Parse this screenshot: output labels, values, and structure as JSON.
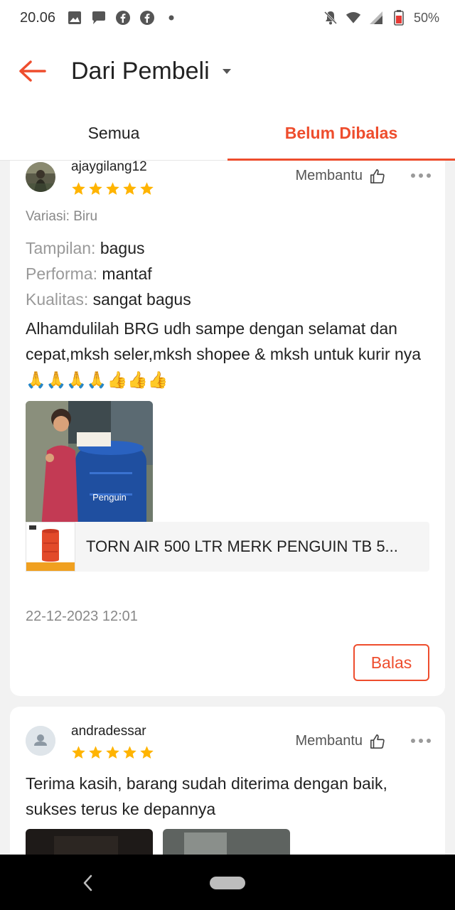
{
  "status_bar": {
    "time": "20.06",
    "battery": "50%",
    "icons": [
      "image-icon",
      "chat-bubble-icon",
      "facebook-icon",
      "facebook-icon",
      "dot-icon",
      "bell-off-icon",
      "wifi-icon",
      "signal-icon",
      "battery-icon"
    ]
  },
  "header": {
    "title": "Dari Pembeli",
    "accent_color": "#ee4d2d"
  },
  "tabs": [
    {
      "label": "Semua",
      "active": false
    },
    {
      "label": "Belum Dibalas",
      "active": true
    }
  ],
  "reviews": [
    {
      "username": "ajaygilang12",
      "rating": 5,
      "helpful_label": "Membantu",
      "variation": "Variasi: Biru",
      "attributes": [
        {
          "key": "Tampilan:",
          "value": "bagus"
        },
        {
          "key": "Performa:",
          "value": "mantaf"
        },
        {
          "key": "Kualitas:",
          "value": "sangat bagus"
        }
      ],
      "text": "Alhamdulilah BRG udh sampe dengan selamat dan cepat,mksh seler,mksh shopee & mksh untuk kurir nya 🙏🙏🙏🙏👍👍👍",
      "photo_text": "Penguin",
      "product_name": "TORN AIR 500 LTR MERK PENGUIN TB 5...",
      "date": "22-12-2023 12:01",
      "reply_label": "Balas"
    },
    {
      "username": "andradessar",
      "rating": 5,
      "helpful_label": "Membantu",
      "text": "Terima kasih, barang sudah diterima dengan baik, sukses terus ke depannya"
    }
  ]
}
